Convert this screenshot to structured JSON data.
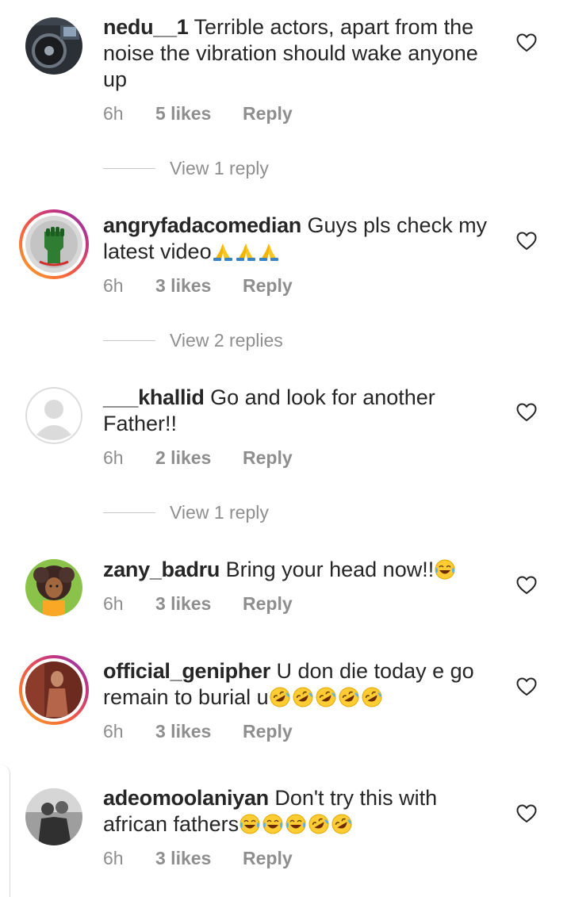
{
  "comments": [
    {
      "username": "nedu__1",
      "text": "Terrible actors, apart from the noise the vibration should wake anyone up",
      "time": "6h",
      "likes": "5 likes",
      "reply": "Reply",
      "view_replies": "View 1 reply",
      "avatar": "car-interior-photo"
    },
    {
      "username": "angryfadacomedian",
      "text": "Guys pls check my latest video",
      "emojis": [
        "folded-hands",
        "folded-hands",
        "folded-hands"
      ],
      "time": "6h",
      "likes": "3 likes",
      "reply": "Reply",
      "view_replies": "View 2 replies",
      "avatar": "raised-fist-logo"
    },
    {
      "username": "___khallid",
      "text": "Go and look for another Father!!",
      "time": "6h",
      "likes": "2 likes",
      "reply": "Reply",
      "view_replies": "View 1 reply",
      "avatar": "default-profile"
    },
    {
      "username": "zany_badru",
      "text": "Bring your head now!!",
      "emojis": [
        "face-with-tears-of-joy"
      ],
      "time": "6h",
      "likes": "3 likes",
      "reply": "Reply",
      "avatar": "cartoon-girl"
    },
    {
      "username": "official_genipher",
      "text": "U don die today e go remain to burial u",
      "emojis": [
        "rolling-on-floor-laughing",
        "rolling-on-floor-laughing",
        "rolling-on-floor-laughing",
        "rolling-on-floor-laughing",
        "rolling-on-floor-laughing"
      ],
      "time": "6h",
      "likes": "3 likes",
      "reply": "Reply",
      "avatar": "person-photo"
    },
    {
      "username": "adeomoolaniyan",
      "text": "Don't try this with african fathers",
      "emojis": [
        "face-with-tears-of-joy",
        "face-with-tears-of-joy",
        "face-with-tears-of-joy",
        "rolling-on-floor-laughing",
        "rolling-on-floor-laughing"
      ],
      "time": "6h",
      "likes": "3 likes",
      "reply": "Reply",
      "avatar": "bw-photo"
    }
  ],
  "colors": {
    "text": "#262626",
    "secondary": "#8e8e8e",
    "divider": "#c7c7c7",
    "story_ring_start": "#f9a825",
    "story_ring_end": "#833ab4"
  },
  "icons": {
    "like": "heart-outline-icon"
  }
}
